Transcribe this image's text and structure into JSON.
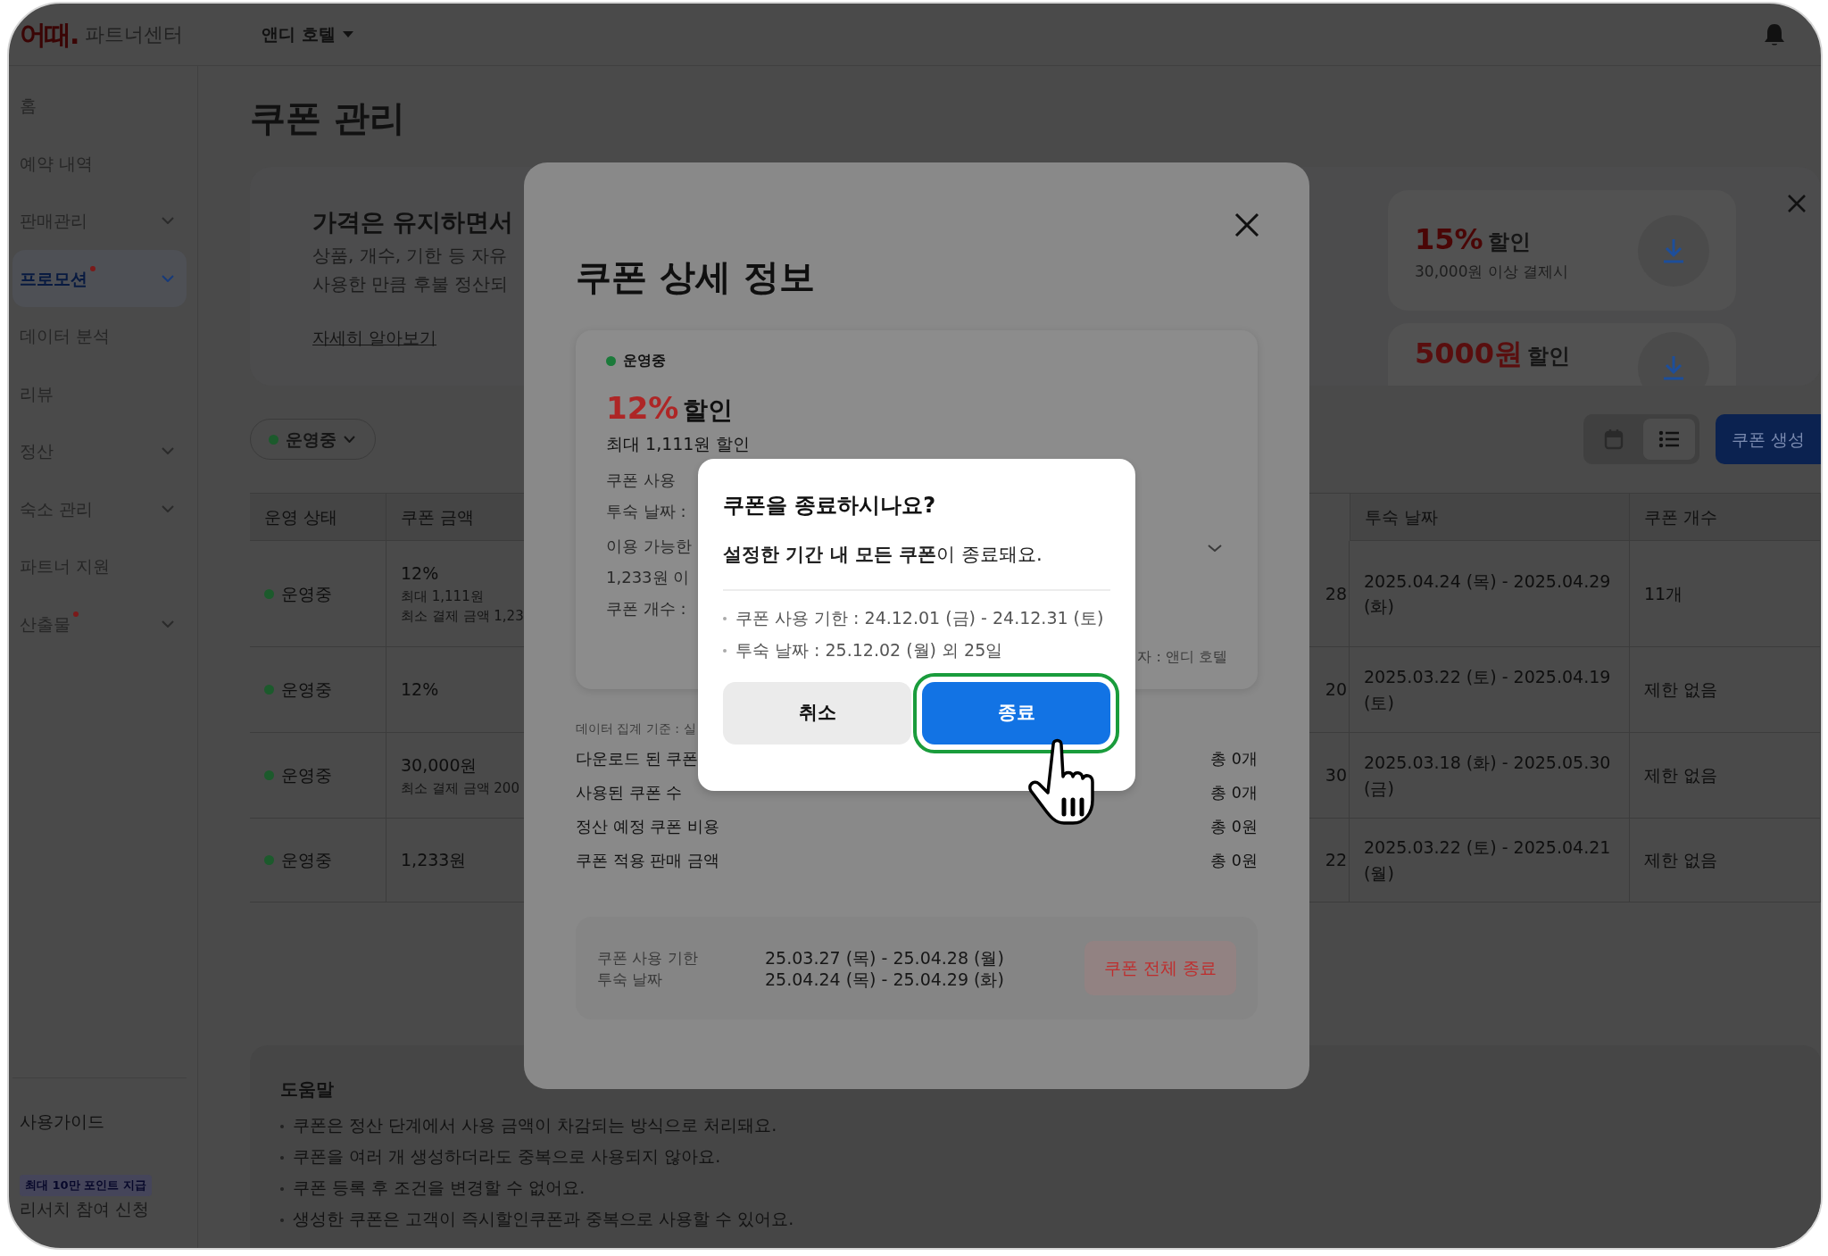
{
  "header": {
    "logo": "어때.",
    "product": "파트너센터",
    "property": "앤디 호텔"
  },
  "sidebar": {
    "items": [
      {
        "label": "홈",
        "expandable": false,
        "selected": false,
        "new": false
      },
      {
        "label": "예약 내역",
        "expandable": false,
        "selected": false,
        "new": false
      },
      {
        "label": "판매관리",
        "expandable": true,
        "selected": false,
        "new": false
      },
      {
        "label": "프로모션",
        "expandable": true,
        "selected": true,
        "new": true
      },
      {
        "label": "데이터 분석",
        "expandable": false,
        "selected": false,
        "new": false
      },
      {
        "label": "리뷰",
        "expandable": false,
        "selected": false,
        "new": false
      },
      {
        "label": "정산",
        "expandable": true,
        "selected": false,
        "new": false
      },
      {
        "label": "숙소 관리",
        "expandable": true,
        "selected": false,
        "new": false
      },
      {
        "label": "파트너 지원",
        "expandable": false,
        "selected": false,
        "new": false
      },
      {
        "label": "산출물",
        "expandable": true,
        "selected": false,
        "new": true
      }
    ],
    "guide": "사용가이드",
    "research_badge": "최대 10만 포인트 지급",
    "research": "리서치 참여 신청"
  },
  "page_title": "쿠폰 관리",
  "banner": {
    "title": "가격은 유지하면서",
    "lines": [
      "상품, 개수, 기한 등 자유",
      "사용한 만큼 후불 정산되"
    ],
    "link": "자세히 알아보기",
    "coupons": [
      {
        "amount": "15%",
        "suffix": "할인",
        "condition": "30,000원 이상 결제시"
      },
      {
        "amount": "5000원",
        "suffix": "할인"
      }
    ]
  },
  "filter": {
    "label": "운영중",
    "color": "#1c5a2c"
  },
  "view_toggle": [
    {
      "kind": "calendar",
      "selected": false
    },
    {
      "kind": "list",
      "selected": true
    }
  ],
  "create_button": "쿠폰 생성",
  "table": {
    "columns": [
      "운영 상태",
      "쿠폰 금액",
      "투숙 날짜",
      "쿠폰 개수"
    ],
    "rows": [
      {
        "status": "운영중",
        "color": "#1c5a2c",
        "amount": [
          "12%",
          "최대 1,111원",
          "최소 결제 금액 1,23"
        ],
        "column_5": "28",
        "stay": "2025.04.24 (목) - 2025.04.29 (화)",
        "count": "11개"
      },
      {
        "status": "운영중",
        "color": "#1c5a2c",
        "amount": [
          "12%"
        ],
        "column_5": "20",
        "stay": "2025.03.22 (토) - 2025.04.19 (토)",
        "count": "제한 없음"
      },
      {
        "status": "운영중",
        "color": "#1c5a2c",
        "amount": [
          "30,000원",
          "최소 결제 금액 200"
        ],
        "column_5": "30",
        "stay": "2025.03.18 (화) - 2025.05.30 (금)",
        "count": "제한 없음"
      },
      {
        "status": "운영중",
        "color": "#1c5a2c",
        "amount": [
          "1,233원"
        ],
        "column_5": "22",
        "stay": "2025.03.22 (토) - 2025.04.21 (월)",
        "count": "제한 없음"
      }
    ]
  },
  "help": {
    "title": "도움말",
    "items": [
      "쿠폰은 정산 단계에서 사용 금액이 차감되는 방식으로 처리돼요.",
      "쿠폰을 여러 개 생성하더라도 중복으로 사용되지 않아요.",
      "쿠폰 등록 후 조건을 변경할 수 없어요.",
      "생성한 쿠폰은 고객이 즉시할인쿠폰과 중복으로 사용할 수 있어요."
    ]
  },
  "detail_modal": {
    "title": "쿠폰 상세 정보",
    "status": {
      "label": "운영중",
      "color": "#1b7a3a"
    },
    "amount": "12%",
    "suffix": "할인",
    "max": "최대 1,111원 할인",
    "info": [
      "쿠폰 사용",
      "투숙 날짜 :"
    ],
    "conditions": [
      "이용 가능한",
      "1,233원 이",
      "쿠폰 개수 :"
    ],
    "creator": "자 : 앤디 호텔",
    "basis": "데이터 집계 기준 : 실",
    "stats": [
      {
        "label": "다운로드 된 쿠폰",
        "value": "총 0개"
      },
      {
        "label": "사용된 쿠폰 수",
        "value": "총 0개"
      },
      {
        "label": "정산 예정 쿠폰 비용",
        "value": "총 0원"
      },
      {
        "label": "쿠폰 적용 판매 금액",
        "value": "총 0원"
      }
    ],
    "period": [
      {
        "label": "쿠폰 사용 기한",
        "value": "25.03.27 (목) - 25.04.28 (월)"
      },
      {
        "label": "투숙 날짜",
        "value": "25.04.24 (목) - 25.04.29 (화)"
      }
    ],
    "end_button": "쿠폰 전체 종료"
  },
  "confirm_dialog": {
    "title": "쿠폰을 종료하시나요?",
    "message": "**설정한 기간 내 모든 쿠폰**이 종료돼요.",
    "details": [
      "쿠폰 사용 기한 : 24.12.01 (금) - 24.12.31 (토)",
      "투숙 날짜 : 25.12.02 (월) 외 25일"
    ],
    "buttons": [
      {
        "label": "취소",
        "kind": "secondary",
        "highlighted": false
      },
      {
        "label": "종료",
        "kind": "primary",
        "highlighted": true
      }
    ]
  }
}
